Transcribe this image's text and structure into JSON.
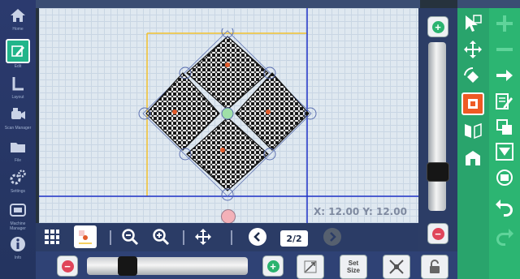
{
  "sidebar": {
    "items": [
      {
        "label": "Home",
        "icon": "home-icon"
      },
      {
        "label": "Edit",
        "icon": "edit-icon"
      },
      {
        "label": "Layout",
        "icon": "layout-icon"
      },
      {
        "label": "Scan Manager",
        "icon": "scanner-icon"
      },
      {
        "label": "File",
        "icon": "folder-icon"
      },
      {
        "label": "Settings",
        "icon": "settings-icon"
      },
      {
        "label": "Machine Manager",
        "icon": "machine-icon"
      },
      {
        "label": "Info",
        "icon": "info-icon"
      }
    ]
  },
  "canvas": {
    "coordinates": "X: 12.00 Y: 12.00"
  },
  "toolbar": {
    "page_indicator": "2/2",
    "set_size_line1": "Set",
    "set_size_line2": "Size"
  },
  "colors": {
    "accent_green": "#2cb572",
    "selected_orange": "#ef5a24",
    "sidebar_blue": "#2b3a6e"
  }
}
